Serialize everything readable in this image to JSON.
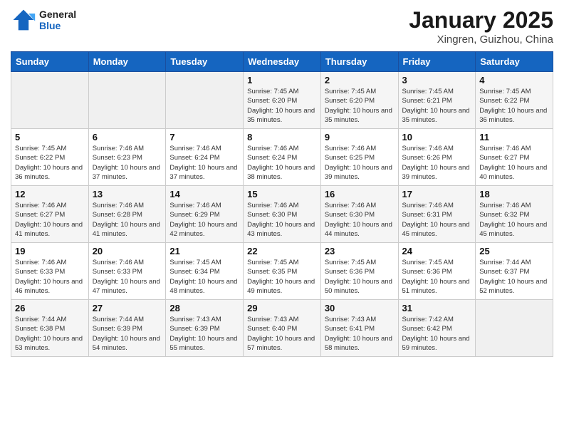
{
  "header": {
    "logo_line1": "General",
    "logo_line2": "Blue",
    "month": "January 2025",
    "location": "Xingren, Guizhou, China"
  },
  "weekdays": [
    "Sunday",
    "Monday",
    "Tuesday",
    "Wednesday",
    "Thursday",
    "Friday",
    "Saturday"
  ],
  "weeks": [
    [
      {
        "day": "",
        "sunrise": "",
        "sunset": "",
        "daylight": ""
      },
      {
        "day": "",
        "sunrise": "",
        "sunset": "",
        "daylight": ""
      },
      {
        "day": "",
        "sunrise": "",
        "sunset": "",
        "daylight": ""
      },
      {
        "day": "1",
        "sunrise": "Sunrise: 7:45 AM",
        "sunset": "Sunset: 6:20 PM",
        "daylight": "Daylight: 10 hours and 35 minutes."
      },
      {
        "day": "2",
        "sunrise": "Sunrise: 7:45 AM",
        "sunset": "Sunset: 6:20 PM",
        "daylight": "Daylight: 10 hours and 35 minutes."
      },
      {
        "day": "3",
        "sunrise": "Sunrise: 7:45 AM",
        "sunset": "Sunset: 6:21 PM",
        "daylight": "Daylight: 10 hours and 35 minutes."
      },
      {
        "day": "4",
        "sunrise": "Sunrise: 7:45 AM",
        "sunset": "Sunset: 6:22 PM",
        "daylight": "Daylight: 10 hours and 36 minutes."
      }
    ],
    [
      {
        "day": "5",
        "sunrise": "Sunrise: 7:45 AM",
        "sunset": "Sunset: 6:22 PM",
        "daylight": "Daylight: 10 hours and 36 minutes."
      },
      {
        "day": "6",
        "sunrise": "Sunrise: 7:46 AM",
        "sunset": "Sunset: 6:23 PM",
        "daylight": "Daylight: 10 hours and 37 minutes."
      },
      {
        "day": "7",
        "sunrise": "Sunrise: 7:46 AM",
        "sunset": "Sunset: 6:24 PM",
        "daylight": "Daylight: 10 hours and 37 minutes."
      },
      {
        "day": "8",
        "sunrise": "Sunrise: 7:46 AM",
        "sunset": "Sunset: 6:24 PM",
        "daylight": "Daylight: 10 hours and 38 minutes."
      },
      {
        "day": "9",
        "sunrise": "Sunrise: 7:46 AM",
        "sunset": "Sunset: 6:25 PM",
        "daylight": "Daylight: 10 hours and 39 minutes."
      },
      {
        "day": "10",
        "sunrise": "Sunrise: 7:46 AM",
        "sunset": "Sunset: 6:26 PM",
        "daylight": "Daylight: 10 hours and 39 minutes."
      },
      {
        "day": "11",
        "sunrise": "Sunrise: 7:46 AM",
        "sunset": "Sunset: 6:27 PM",
        "daylight": "Daylight: 10 hours and 40 minutes."
      }
    ],
    [
      {
        "day": "12",
        "sunrise": "Sunrise: 7:46 AM",
        "sunset": "Sunset: 6:27 PM",
        "daylight": "Daylight: 10 hours and 41 minutes."
      },
      {
        "day": "13",
        "sunrise": "Sunrise: 7:46 AM",
        "sunset": "Sunset: 6:28 PM",
        "daylight": "Daylight: 10 hours and 41 minutes."
      },
      {
        "day": "14",
        "sunrise": "Sunrise: 7:46 AM",
        "sunset": "Sunset: 6:29 PM",
        "daylight": "Daylight: 10 hours and 42 minutes."
      },
      {
        "day": "15",
        "sunrise": "Sunrise: 7:46 AM",
        "sunset": "Sunset: 6:30 PM",
        "daylight": "Daylight: 10 hours and 43 minutes."
      },
      {
        "day": "16",
        "sunrise": "Sunrise: 7:46 AM",
        "sunset": "Sunset: 6:30 PM",
        "daylight": "Daylight: 10 hours and 44 minutes."
      },
      {
        "day": "17",
        "sunrise": "Sunrise: 7:46 AM",
        "sunset": "Sunset: 6:31 PM",
        "daylight": "Daylight: 10 hours and 45 minutes."
      },
      {
        "day": "18",
        "sunrise": "Sunrise: 7:46 AM",
        "sunset": "Sunset: 6:32 PM",
        "daylight": "Daylight: 10 hours and 45 minutes."
      }
    ],
    [
      {
        "day": "19",
        "sunrise": "Sunrise: 7:46 AM",
        "sunset": "Sunset: 6:33 PM",
        "daylight": "Daylight: 10 hours and 46 minutes."
      },
      {
        "day": "20",
        "sunrise": "Sunrise: 7:46 AM",
        "sunset": "Sunset: 6:33 PM",
        "daylight": "Daylight: 10 hours and 47 minutes."
      },
      {
        "day": "21",
        "sunrise": "Sunrise: 7:45 AM",
        "sunset": "Sunset: 6:34 PM",
        "daylight": "Daylight: 10 hours and 48 minutes."
      },
      {
        "day": "22",
        "sunrise": "Sunrise: 7:45 AM",
        "sunset": "Sunset: 6:35 PM",
        "daylight": "Daylight: 10 hours and 49 minutes."
      },
      {
        "day": "23",
        "sunrise": "Sunrise: 7:45 AM",
        "sunset": "Sunset: 6:36 PM",
        "daylight": "Daylight: 10 hours and 50 minutes."
      },
      {
        "day": "24",
        "sunrise": "Sunrise: 7:45 AM",
        "sunset": "Sunset: 6:36 PM",
        "daylight": "Daylight: 10 hours and 51 minutes."
      },
      {
        "day": "25",
        "sunrise": "Sunrise: 7:44 AM",
        "sunset": "Sunset: 6:37 PM",
        "daylight": "Daylight: 10 hours and 52 minutes."
      }
    ],
    [
      {
        "day": "26",
        "sunrise": "Sunrise: 7:44 AM",
        "sunset": "Sunset: 6:38 PM",
        "daylight": "Daylight: 10 hours and 53 minutes."
      },
      {
        "day": "27",
        "sunrise": "Sunrise: 7:44 AM",
        "sunset": "Sunset: 6:39 PM",
        "daylight": "Daylight: 10 hours and 54 minutes."
      },
      {
        "day": "28",
        "sunrise": "Sunrise: 7:43 AM",
        "sunset": "Sunset: 6:39 PM",
        "daylight": "Daylight: 10 hours and 55 minutes."
      },
      {
        "day": "29",
        "sunrise": "Sunrise: 7:43 AM",
        "sunset": "Sunset: 6:40 PM",
        "daylight": "Daylight: 10 hours and 57 minutes."
      },
      {
        "day": "30",
        "sunrise": "Sunrise: 7:43 AM",
        "sunset": "Sunset: 6:41 PM",
        "daylight": "Daylight: 10 hours and 58 minutes."
      },
      {
        "day": "31",
        "sunrise": "Sunrise: 7:42 AM",
        "sunset": "Sunset: 6:42 PM",
        "daylight": "Daylight: 10 hours and 59 minutes."
      },
      {
        "day": "",
        "sunrise": "",
        "sunset": "",
        "daylight": ""
      }
    ]
  ]
}
